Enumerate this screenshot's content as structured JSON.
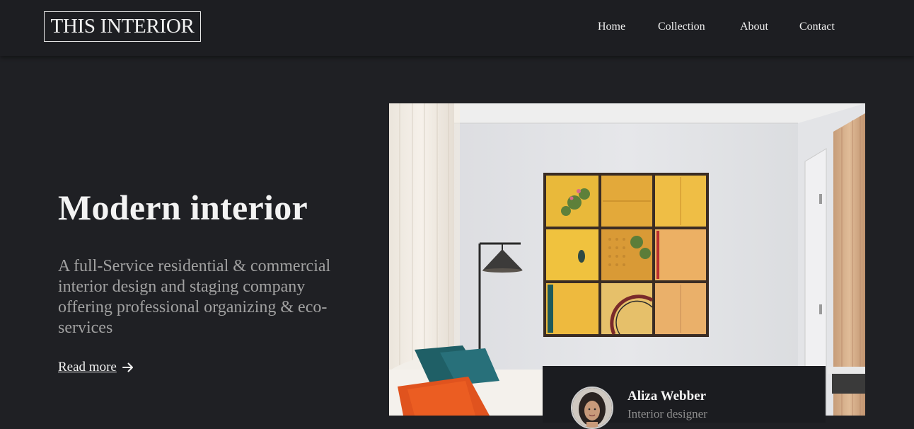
{
  "header": {
    "logo": "THIS INTERIOR",
    "nav": [
      {
        "label": "Home"
      },
      {
        "label": "Collection"
      },
      {
        "label": "About"
      },
      {
        "label": "Contact"
      }
    ]
  },
  "hero": {
    "title": "Modern interior",
    "description": "A full-Service residential & commercial interior design and staging company offering professional organizing & eco-services",
    "read_more": "Read more",
    "read_more_icon": "arrow-right-icon",
    "image": "living-room-with-floor-lamp-and-framed-wall-art"
  },
  "designer": {
    "name": "Aliza Webber",
    "role": "Interior designer",
    "avatar": "designer-avatar"
  },
  "colors": {
    "background": "#1f2024",
    "header": "#1d1e22",
    "accent": "#f3f3f3",
    "muted_text": "#a1a1a1"
  }
}
